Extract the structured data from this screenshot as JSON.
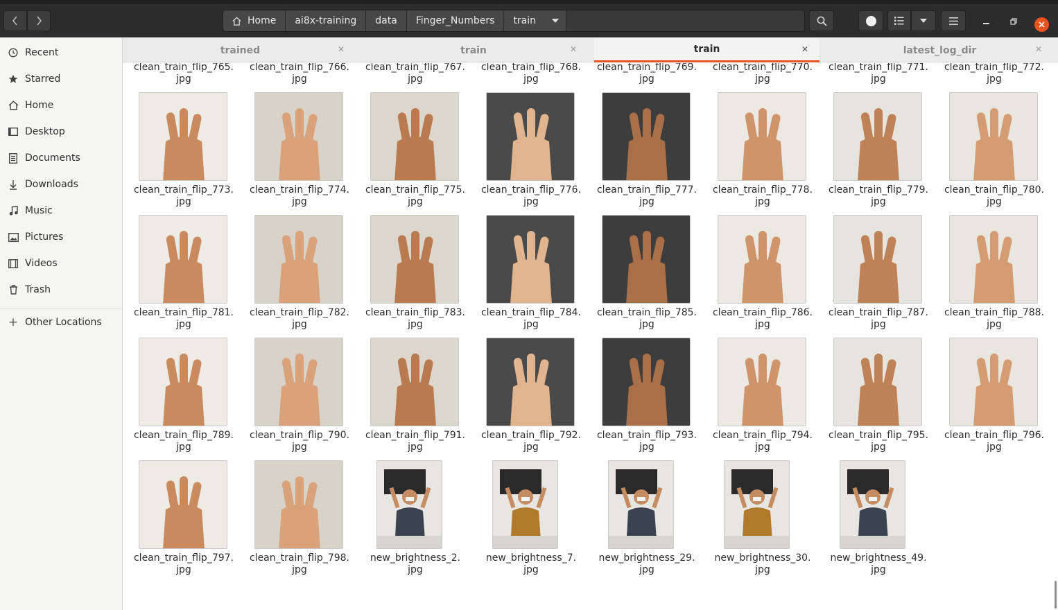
{
  "header": {
    "breadcrumbs": [
      "Home",
      "ai8x-training",
      "data",
      "Finger_Numbers",
      "train"
    ]
  },
  "sidebar": {
    "items": [
      {
        "label": "Recent",
        "icon": "clock-icon"
      },
      {
        "label": "Starred",
        "icon": "star-icon"
      },
      {
        "label": "Home",
        "icon": "home-icon"
      },
      {
        "label": "Desktop",
        "icon": "desktop-icon"
      },
      {
        "label": "Documents",
        "icon": "document-icon"
      },
      {
        "label": "Downloads",
        "icon": "download-icon"
      },
      {
        "label": "Music",
        "icon": "music-icon"
      },
      {
        "label": "Pictures",
        "icon": "picture-icon"
      },
      {
        "label": "Videos",
        "icon": "video-icon"
      },
      {
        "label": "Trash",
        "icon": "trash-icon"
      }
    ],
    "other_locations": "Other Locations"
  },
  "tabs": [
    {
      "label": "trained",
      "active": false
    },
    {
      "label": "train",
      "active": false
    },
    {
      "label": "train",
      "active": true
    },
    {
      "label": "latest_log_dir",
      "active": false
    }
  ],
  "files": [
    {
      "line1": "clean_train_flip_765.",
      "line2": "jpg"
    },
    {
      "line1": "clean_train_flip_766.",
      "line2": "jpg"
    },
    {
      "line1": "clean_train_flip_767.",
      "line2": "jpg"
    },
    {
      "line1": "clean_train_flip_768.",
      "line2": "jpg"
    },
    {
      "line1": "clean_train_flip_769.",
      "line2": "jpg"
    },
    {
      "line1": "clean_train_flip_770.",
      "line2": "jpg"
    },
    {
      "line1": "clean_train_flip_771.",
      "line2": "jpg"
    },
    {
      "line1": "clean_train_flip_772.",
      "line2": "jpg"
    },
    {
      "line1": "clean_train_flip_773.",
      "line2": "jpg"
    },
    {
      "line1": "clean_train_flip_774.",
      "line2": "jpg"
    },
    {
      "line1": "clean_train_flip_775.",
      "line2": "jpg"
    },
    {
      "line1": "clean_train_flip_776.",
      "line2": "jpg"
    },
    {
      "line1": "clean_train_flip_777.",
      "line2": "jpg"
    },
    {
      "line1": "clean_train_flip_778.",
      "line2": "jpg"
    },
    {
      "line1": "clean_train_flip_779.",
      "line2": "jpg"
    },
    {
      "line1": "clean_train_flip_780.",
      "line2": "jpg"
    },
    {
      "line1": "clean_train_flip_781.",
      "line2": "jpg"
    },
    {
      "line1": "clean_train_flip_782.",
      "line2": "jpg"
    },
    {
      "line1": "clean_train_flip_783.",
      "line2": "jpg"
    },
    {
      "line1": "clean_train_flip_784.",
      "line2": "jpg"
    },
    {
      "line1": "clean_train_flip_785.",
      "line2": "jpg"
    },
    {
      "line1": "clean_train_flip_786.",
      "line2": "jpg"
    },
    {
      "line1": "clean_train_flip_787.",
      "line2": "jpg"
    },
    {
      "line1": "clean_train_flip_788.",
      "line2": "jpg"
    },
    {
      "line1": "clean_train_flip_789.",
      "line2": "jpg"
    },
    {
      "line1": "clean_train_flip_790.",
      "line2": "jpg"
    },
    {
      "line1": "clean_train_flip_791.",
      "line2": "jpg"
    },
    {
      "line1": "clean_train_flip_792.",
      "line2": "jpg"
    },
    {
      "line1": "clean_train_flip_793.",
      "line2": "jpg"
    },
    {
      "line1": "clean_train_flip_794.",
      "line2": "jpg"
    },
    {
      "line1": "clean_train_flip_795.",
      "line2": "jpg"
    },
    {
      "line1": "clean_train_flip_796.",
      "line2": "jpg"
    },
    {
      "line1": "clean_train_flip_797.",
      "line2": "jpg"
    },
    {
      "line1": "clean_train_flip_798.",
      "line2": "jpg"
    },
    {
      "line1": "new_brightness_2.",
      "line2": "jpg"
    },
    {
      "line1": "new_brightness_7.",
      "line2": "jpg"
    },
    {
      "line1": "new_brightness_29.",
      "line2": "jpg"
    },
    {
      "line1": "new_brightness_30.",
      "line2": "jpg"
    },
    {
      "line1": "new_brightness_49.",
      "line2": "jpg"
    }
  ],
  "colors": {
    "accent": "#e95420",
    "headerbar": "#2c2c2c",
    "sidebar": "#f5f5f4"
  }
}
